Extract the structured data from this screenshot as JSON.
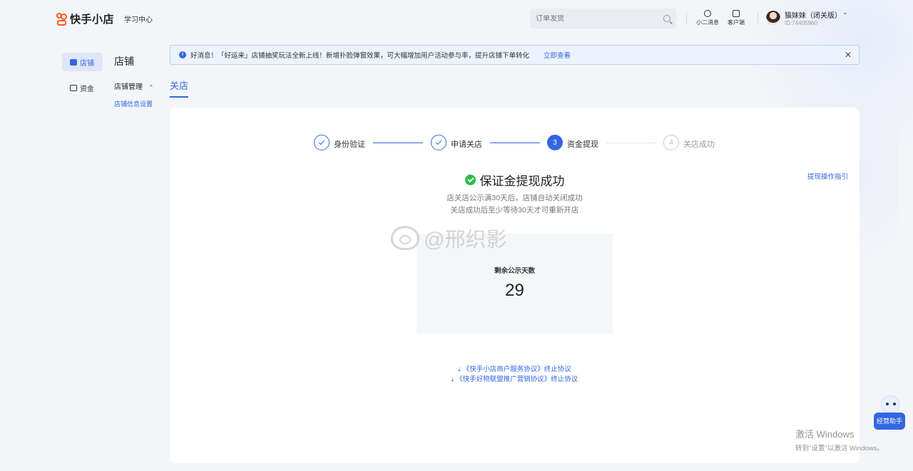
{
  "app": {
    "logo_text": "快手小店",
    "learn_center": "学习中心"
  },
  "search": {
    "placeholder": "订单发货"
  },
  "header_actions": [
    {
      "label": "小二消息",
      "icon": "chat-icon"
    },
    {
      "label": "客户端",
      "icon": "monitor-icon"
    }
  ],
  "user": {
    "name": "猫妹妹（闭关版）",
    "id": "ID:74405960"
  },
  "nav": {
    "items": [
      {
        "label": "店铺",
        "icon": "store-icon",
        "active": true
      },
      {
        "label": "资金",
        "icon": "wallet-icon",
        "active": false
      }
    ],
    "section_title": "店铺",
    "group_label": "店铺管理",
    "sub_link": "店铺信息设置"
  },
  "banner": {
    "text": "好消息！「好运来」店铺抽奖玩法全新上线！新增扑脸弹窗效果，可大幅增加用户活动参与率，提升店铺下单转化",
    "link": "立即查看"
  },
  "tab": {
    "label": "关店"
  },
  "steps": [
    {
      "label": "身份验证",
      "state": "done",
      "number": "1"
    },
    {
      "label": "申请关店",
      "state": "done",
      "number": "2"
    },
    {
      "label": "资金提现",
      "state": "current",
      "number": "3"
    },
    {
      "label": "关店成功",
      "state": "pending",
      "number": "4"
    }
  ],
  "result": {
    "title": "保证金提现成功",
    "guide_link": "提现操作指引",
    "desc1": "店关店公示满30天后，店铺自动关闭成功",
    "desc2": "关店成功后至少等待30天才可重新开店",
    "count_label": "剩余公示天数",
    "count_value": "29"
  },
  "agreements": [
    "《快手小店商户服务协议》终止协议",
    "《快手好物联盟推广营销协议》终止协议"
  ],
  "watermark": {
    "text": "@邢织影"
  },
  "assistant": {
    "label": "经营助手"
  },
  "windows": {
    "line1": "激活 Windows",
    "line2": "转到\"设置\"以激活 Windows。"
  },
  "colors": {
    "accent": "#3366e0",
    "success": "#2cbc4e",
    "brand": "#fe5a1f"
  }
}
